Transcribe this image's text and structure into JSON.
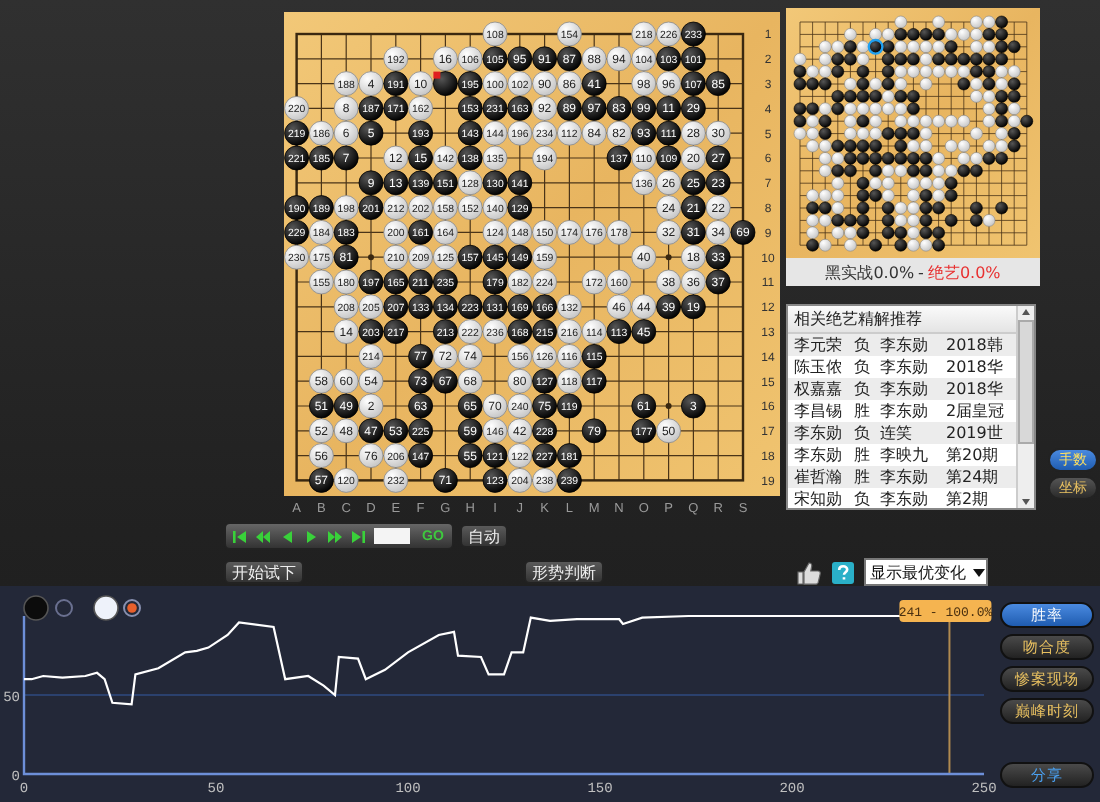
{
  "board": {
    "columns": [
      "A",
      "B",
      "C",
      "D",
      "E",
      "F",
      "G",
      "H",
      "I",
      "J",
      "K",
      "L",
      "M",
      "N",
      "O",
      "P",
      "Q",
      "R",
      "S"
    ],
    "rows": [
      {
        "label": "1",
        "points": [
          {
            "kind": "empty"
          },
          {
            "kind": "empty"
          },
          {
            "kind": "empty"
          },
          {
            "kind": "empty"
          },
          {
            "kind": "empty"
          },
          {
            "kind": "empty"
          },
          {
            "kind": "empty"
          },
          {
            "kind": "empty"
          },
          {
            "kind": "white",
            "label": "108",
            "last_move": false
          },
          {
            "kind": "empty"
          },
          {
            "kind": "empty"
          },
          {
            "kind": "white",
            "label": "154",
            "last_move": false
          },
          {
            "kind": "empty"
          },
          {
            "kind": "empty"
          },
          {
            "kind": "white",
            "label": "218",
            "last_move": false
          },
          {
            "kind": "white",
            "label": "226",
            "last_move": false
          },
          {
            "kind": "black",
            "label": "233",
            "last_move": false
          },
          {
            "kind": "empty"
          },
          {
            "kind": "empty"
          }
        ]
      },
      {
        "label": "2",
        "points": [
          {
            "kind": "empty"
          },
          {
            "kind": "empty"
          },
          {
            "kind": "empty"
          },
          {
            "kind": "empty"
          },
          {
            "kind": "white",
            "label": "192",
            "last_move": false
          },
          {
            "kind": "empty"
          },
          {
            "kind": "white",
            "label": "16",
            "last_move": false
          },
          {
            "kind": "white",
            "label": "106",
            "last_move": false
          },
          {
            "kind": "black",
            "label": "105",
            "last_move": false
          },
          {
            "kind": "black",
            "label": "95",
            "last_move": false
          },
          {
            "kind": "black",
            "label": "91",
            "last_move": false
          },
          {
            "kind": "black",
            "label": "87",
            "last_move": false
          },
          {
            "kind": "white",
            "label": "88",
            "last_move": false
          },
          {
            "kind": "white",
            "label": "94",
            "last_move": false
          },
          {
            "kind": "white",
            "label": "104",
            "last_move": false
          },
          {
            "kind": "black",
            "label": "103",
            "last_move": false
          },
          {
            "kind": "black",
            "label": "101",
            "last_move": false
          },
          {
            "kind": "empty"
          },
          {
            "kind": "empty"
          }
        ]
      },
      {
        "label": "3",
        "points": [
          {
            "kind": "empty"
          },
          {
            "kind": "empty"
          },
          {
            "kind": "white",
            "label": "188",
            "last_move": false
          },
          {
            "kind": "white",
            "label": "4",
            "last_move": false
          },
          {
            "kind": "black",
            "label": "191",
            "last_move": false
          },
          {
            "kind": "white",
            "label": "10",
            "last_move": false
          },
          {
            "kind": "black",
            "last_move": true
          },
          {
            "kind": "black",
            "label": "195",
            "last_move": false
          },
          {
            "kind": "white",
            "label": "100",
            "last_move": false
          },
          {
            "kind": "white",
            "label": "102",
            "last_move": false
          },
          {
            "kind": "white",
            "label": "90",
            "last_move": false
          },
          {
            "kind": "white",
            "label": "86",
            "last_move": false
          },
          {
            "kind": "black",
            "label": "41",
            "last_move": false
          },
          {
            "kind": "empty"
          },
          {
            "kind": "white",
            "label": "98",
            "last_move": false
          },
          {
            "kind": "white",
            "label": "96",
            "last_move": false
          },
          {
            "kind": "black",
            "label": "107",
            "last_move": false
          },
          {
            "kind": "black",
            "label": "85",
            "last_move": false
          },
          {
            "kind": "empty"
          }
        ]
      },
      {
        "label": "4",
        "points": [
          {
            "kind": "white",
            "label": "220",
            "last_move": false
          },
          {
            "kind": "empty"
          },
          {
            "kind": "white",
            "label": "8",
            "last_move": false
          },
          {
            "kind": "black",
            "label": "187",
            "last_move": false
          },
          {
            "kind": "black",
            "label": "171",
            "last_move": false
          },
          {
            "kind": "white",
            "label": "162",
            "last_move": false
          },
          {
            "kind": "empty"
          },
          {
            "kind": "black",
            "label": "153",
            "last_move": false
          },
          {
            "kind": "black",
            "label": "231",
            "last_move": false
          },
          {
            "kind": "black",
            "label": "163",
            "last_move": false
          },
          {
            "kind": "white",
            "label": "92",
            "last_move": false
          },
          {
            "kind": "black",
            "label": "89",
            "last_move": false
          },
          {
            "kind": "black",
            "label": "97",
            "last_move": false
          },
          {
            "kind": "black",
            "label": "83",
            "last_move": false
          },
          {
            "kind": "black",
            "label": "99",
            "last_move": false
          },
          {
            "kind": "black",
            "label": "11",
            "last_move": false
          },
          {
            "kind": "black",
            "label": "29",
            "last_move": false
          },
          {
            "kind": "empty"
          },
          {
            "kind": "empty"
          }
        ]
      },
      {
        "label": "5",
        "points": [
          {
            "kind": "black",
            "label": "219",
            "last_move": false
          },
          {
            "kind": "white",
            "label": "186",
            "last_move": false
          },
          {
            "kind": "white",
            "label": "6",
            "last_move": false
          },
          {
            "kind": "black",
            "label": "5",
            "last_move": false
          },
          {
            "kind": "empty"
          },
          {
            "kind": "black",
            "label": "193",
            "last_move": false
          },
          {
            "kind": "empty"
          },
          {
            "kind": "black",
            "label": "143",
            "last_move": false
          },
          {
            "kind": "white",
            "label": "144",
            "last_move": false
          },
          {
            "kind": "white",
            "label": "196",
            "last_move": false
          },
          {
            "kind": "white",
            "label": "234",
            "last_move": false
          },
          {
            "kind": "white",
            "label": "112",
            "last_move": false
          },
          {
            "kind": "white",
            "label": "84",
            "last_move": false
          },
          {
            "kind": "white",
            "label": "82",
            "last_move": false
          },
          {
            "kind": "black",
            "label": "93",
            "last_move": false
          },
          {
            "kind": "black",
            "label": "111",
            "last_move": false
          },
          {
            "kind": "white",
            "label": "28",
            "last_move": false
          },
          {
            "kind": "white",
            "label": "30",
            "last_move": false
          },
          {
            "kind": "empty"
          }
        ]
      },
      {
        "label": "6",
        "points": [
          {
            "kind": "black",
            "label": "221",
            "last_move": false
          },
          {
            "kind": "black",
            "label": "185",
            "last_move": false
          },
          {
            "kind": "black",
            "label": "7",
            "last_move": false
          },
          {
            "kind": "empty"
          },
          {
            "kind": "white",
            "label": "12",
            "last_move": false
          },
          {
            "kind": "black",
            "label": "15",
            "last_move": false
          },
          {
            "kind": "white",
            "label": "142",
            "last_move": false
          },
          {
            "kind": "black",
            "label": "138",
            "last_move": false
          },
          {
            "kind": "white",
            "label": "135",
            "last_move": false
          },
          {
            "kind": "empty"
          },
          {
            "kind": "white",
            "label": "194",
            "last_move": false
          },
          {
            "kind": "empty"
          },
          {
            "kind": "empty"
          },
          {
            "kind": "black",
            "label": "137",
            "last_move": false
          },
          {
            "kind": "white",
            "label": "110",
            "last_move": false
          },
          {
            "kind": "black",
            "label": "109",
            "last_move": false
          },
          {
            "kind": "white",
            "label": "20",
            "last_move": false
          },
          {
            "kind": "black",
            "label": "27",
            "last_move": false
          },
          {
            "kind": "empty"
          }
        ]
      },
      {
        "label": "7",
        "points": [
          {
            "kind": "empty"
          },
          {
            "kind": "empty"
          },
          {
            "kind": "empty"
          },
          {
            "kind": "black",
            "label": "9",
            "last_move": false
          },
          {
            "kind": "black",
            "label": "13",
            "last_move": false
          },
          {
            "kind": "black",
            "label": "139",
            "last_move": false
          },
          {
            "kind": "black",
            "label": "151",
            "last_move": false
          },
          {
            "kind": "white",
            "label": "128",
            "last_move": false
          },
          {
            "kind": "black",
            "label": "130",
            "last_move": false
          },
          {
            "kind": "black",
            "label": "141",
            "last_move": false
          },
          {
            "kind": "empty"
          },
          {
            "kind": "empty"
          },
          {
            "kind": "empty"
          },
          {
            "kind": "empty"
          },
          {
            "kind": "white",
            "label": "136",
            "last_move": false
          },
          {
            "kind": "white",
            "label": "26",
            "last_move": false
          },
          {
            "kind": "black",
            "label": "25",
            "last_move": false
          },
          {
            "kind": "black",
            "label": "23",
            "last_move": false
          },
          {
            "kind": "empty"
          }
        ]
      },
      {
        "label": "8",
        "points": [
          {
            "kind": "black",
            "label": "190",
            "last_move": false
          },
          {
            "kind": "black",
            "label": "189",
            "last_move": false
          },
          {
            "kind": "white",
            "label": "198",
            "last_move": false
          },
          {
            "kind": "black",
            "label": "201",
            "last_move": false
          },
          {
            "kind": "white",
            "label": "212",
            "last_move": false
          },
          {
            "kind": "white",
            "label": "202",
            "last_move": false
          },
          {
            "kind": "white",
            "label": "158",
            "last_move": false
          },
          {
            "kind": "white",
            "label": "152",
            "last_move": false
          },
          {
            "kind": "white",
            "label": "140",
            "last_move": false
          },
          {
            "kind": "black",
            "label": "129",
            "last_move": false
          },
          {
            "kind": "empty"
          },
          {
            "kind": "empty"
          },
          {
            "kind": "empty"
          },
          {
            "kind": "empty"
          },
          {
            "kind": "empty"
          },
          {
            "kind": "white",
            "label": "24",
            "last_move": false
          },
          {
            "kind": "black",
            "label": "21",
            "last_move": false
          },
          {
            "kind": "white",
            "label": "22",
            "last_move": false
          },
          {
            "kind": "empty"
          }
        ]
      },
      {
        "label": "9",
        "points": [
          {
            "kind": "black",
            "label": "229",
            "last_move": false
          },
          {
            "kind": "white",
            "label": "184",
            "last_move": false
          },
          {
            "kind": "black",
            "label": "183",
            "last_move": false
          },
          {
            "kind": "empty"
          },
          {
            "kind": "white",
            "label": "200",
            "last_move": false
          },
          {
            "kind": "black",
            "label": "161",
            "last_move": false
          },
          {
            "kind": "white",
            "label": "164",
            "last_move": false
          },
          {
            "kind": "empty"
          },
          {
            "kind": "white",
            "label": "124",
            "last_move": false
          },
          {
            "kind": "white",
            "label": "148",
            "last_move": false
          },
          {
            "kind": "white",
            "label": "150",
            "last_move": false
          },
          {
            "kind": "white",
            "label": "174",
            "last_move": false
          },
          {
            "kind": "white",
            "label": "176",
            "last_move": false
          },
          {
            "kind": "white",
            "label": "178",
            "last_move": false
          },
          {
            "kind": "empty"
          },
          {
            "kind": "white",
            "label": "32",
            "last_move": false
          },
          {
            "kind": "black",
            "label": "31",
            "last_move": false
          },
          {
            "kind": "white",
            "label": "34",
            "last_move": false
          },
          {
            "kind": "black",
            "label": "69",
            "last_move": false
          }
        ]
      },
      {
        "label": "10",
        "points": [
          {
            "kind": "white",
            "label": "230",
            "last_move": false
          },
          {
            "kind": "white",
            "label": "175",
            "last_move": false
          },
          {
            "kind": "black",
            "label": "81",
            "last_move": false
          },
          {
            "kind": "empty"
          },
          {
            "kind": "white",
            "label": "210",
            "last_move": false
          },
          {
            "kind": "white",
            "label": "209",
            "last_move": false
          },
          {
            "kind": "white",
            "label": "125",
            "last_move": false
          },
          {
            "kind": "black",
            "label": "157",
            "last_move": false
          },
          {
            "kind": "black",
            "label": "145",
            "last_move": false
          },
          {
            "kind": "black",
            "label": "149",
            "last_move": false
          },
          {
            "kind": "white",
            "label": "159",
            "last_move": false
          },
          {
            "kind": "empty"
          },
          {
            "kind": "empty"
          },
          {
            "kind": "empty"
          },
          {
            "kind": "white",
            "label": "40",
            "last_move": false
          },
          {
            "kind": "empty"
          },
          {
            "kind": "white",
            "label": "18",
            "last_move": false
          },
          {
            "kind": "black",
            "label": "33",
            "last_move": false
          },
          {
            "kind": "empty"
          }
        ]
      },
      {
        "label": "11",
        "points": [
          {
            "kind": "empty"
          },
          {
            "kind": "white",
            "label": "155",
            "last_move": false
          },
          {
            "kind": "white",
            "label": "180",
            "last_move": false
          },
          {
            "kind": "black",
            "label": "197",
            "last_move": false
          },
          {
            "kind": "black",
            "label": "165",
            "last_move": false
          },
          {
            "kind": "black",
            "label": "211",
            "last_move": false
          },
          {
            "kind": "black",
            "label": "235",
            "last_move": false
          },
          {
            "kind": "empty"
          },
          {
            "kind": "black",
            "label": "179",
            "last_move": false
          },
          {
            "kind": "white",
            "label": "182",
            "last_move": false
          },
          {
            "kind": "white",
            "label": "224",
            "last_move": false
          },
          {
            "kind": "empty"
          },
          {
            "kind": "white",
            "label": "172",
            "last_move": false
          },
          {
            "kind": "white",
            "label": "160",
            "last_move": false
          },
          {
            "kind": "empty"
          },
          {
            "kind": "white",
            "label": "38",
            "last_move": false
          },
          {
            "kind": "white",
            "label": "36",
            "last_move": false
          },
          {
            "kind": "black",
            "label": "37",
            "last_move": false
          },
          {
            "kind": "empty"
          }
        ]
      },
      {
        "label": "12",
        "points": [
          {
            "kind": "empty"
          },
          {
            "kind": "empty"
          },
          {
            "kind": "white",
            "label": "208",
            "last_move": false
          },
          {
            "kind": "white",
            "label": "205",
            "last_move": false
          },
          {
            "kind": "black",
            "label": "207",
            "last_move": false
          },
          {
            "kind": "black",
            "label": "133",
            "last_move": false
          },
          {
            "kind": "black",
            "label": "134",
            "last_move": false
          },
          {
            "kind": "black",
            "label": "223",
            "last_move": false
          },
          {
            "kind": "black",
            "label": "131",
            "last_move": false
          },
          {
            "kind": "black",
            "label": "169",
            "last_move": false
          },
          {
            "kind": "black",
            "label": "166",
            "last_move": false
          },
          {
            "kind": "white",
            "label": "132",
            "last_move": false
          },
          {
            "kind": "empty"
          },
          {
            "kind": "white",
            "label": "46",
            "last_move": false
          },
          {
            "kind": "white",
            "label": "44",
            "last_move": false
          },
          {
            "kind": "black",
            "label": "39",
            "last_move": false
          },
          {
            "kind": "black",
            "label": "19",
            "last_move": false
          },
          {
            "kind": "empty"
          },
          {
            "kind": "empty"
          }
        ]
      },
      {
        "label": "13",
        "points": [
          {
            "kind": "empty"
          },
          {
            "kind": "empty"
          },
          {
            "kind": "white",
            "label": "14",
            "last_move": false
          },
          {
            "kind": "black",
            "label": "203",
            "last_move": false
          },
          {
            "kind": "black",
            "label": "217",
            "last_move": false
          },
          {
            "kind": "empty"
          },
          {
            "kind": "black",
            "label": "213",
            "last_move": false
          },
          {
            "kind": "white",
            "label": "222",
            "last_move": false
          },
          {
            "kind": "white",
            "label": "236",
            "last_move": false
          },
          {
            "kind": "black",
            "label": "168",
            "last_move": false
          },
          {
            "kind": "black",
            "label": "215",
            "last_move": false
          },
          {
            "kind": "white",
            "label": "216",
            "last_move": false
          },
          {
            "kind": "white",
            "label": "114",
            "last_move": false
          },
          {
            "kind": "black",
            "label": "113",
            "last_move": false
          },
          {
            "kind": "black",
            "label": "45",
            "last_move": false
          },
          {
            "kind": "empty"
          },
          {
            "kind": "empty"
          },
          {
            "kind": "empty"
          },
          {
            "kind": "empty"
          }
        ]
      },
      {
        "label": "14",
        "points": [
          {
            "kind": "empty"
          },
          {
            "kind": "empty"
          },
          {
            "kind": "empty"
          },
          {
            "kind": "white",
            "label": "214",
            "last_move": false
          },
          {
            "kind": "empty"
          },
          {
            "kind": "black",
            "label": "77",
            "last_move": false
          },
          {
            "kind": "white",
            "label": "72",
            "last_move": false
          },
          {
            "kind": "white",
            "label": "74",
            "last_move": false
          },
          {
            "kind": "empty"
          },
          {
            "kind": "white",
            "label": "156",
            "last_move": false
          },
          {
            "kind": "white",
            "label": "126",
            "last_move": false
          },
          {
            "kind": "white",
            "label": "116",
            "last_move": false
          },
          {
            "kind": "black",
            "label": "115",
            "last_move": false
          },
          {
            "kind": "empty"
          },
          {
            "kind": "empty"
          },
          {
            "kind": "empty"
          },
          {
            "kind": "empty"
          },
          {
            "kind": "empty"
          },
          {
            "kind": "empty"
          }
        ]
      },
      {
        "label": "15",
        "points": [
          {
            "kind": "empty"
          },
          {
            "kind": "white",
            "label": "58",
            "last_move": false
          },
          {
            "kind": "white",
            "label": "60",
            "last_move": false
          },
          {
            "kind": "white",
            "label": "54",
            "last_move": false
          },
          {
            "kind": "empty"
          },
          {
            "kind": "black",
            "label": "73",
            "last_move": false
          },
          {
            "kind": "black",
            "label": "67",
            "last_move": false
          },
          {
            "kind": "white",
            "label": "68",
            "last_move": false
          },
          {
            "kind": "empty"
          },
          {
            "kind": "white",
            "label": "80",
            "last_move": false
          },
          {
            "kind": "black",
            "label": "127",
            "last_move": false
          },
          {
            "kind": "white",
            "label": "118",
            "last_move": false
          },
          {
            "kind": "black",
            "label": "117",
            "last_move": false
          },
          {
            "kind": "empty"
          },
          {
            "kind": "empty"
          },
          {
            "kind": "empty"
          },
          {
            "kind": "empty"
          },
          {
            "kind": "empty"
          },
          {
            "kind": "empty"
          }
        ]
      },
      {
        "label": "16",
        "points": [
          {
            "kind": "empty"
          },
          {
            "kind": "black",
            "label": "51",
            "last_move": false
          },
          {
            "kind": "black",
            "label": "49",
            "last_move": false
          },
          {
            "kind": "white",
            "label": "2",
            "last_move": false
          },
          {
            "kind": "empty"
          },
          {
            "kind": "black",
            "label": "63",
            "last_move": false
          },
          {
            "kind": "empty"
          },
          {
            "kind": "black",
            "label": "65",
            "last_move": false
          },
          {
            "kind": "white",
            "label": "70",
            "last_move": false
          },
          {
            "kind": "white",
            "label": "240",
            "last_move": false
          },
          {
            "kind": "black",
            "label": "75",
            "last_move": false
          },
          {
            "kind": "black",
            "label": "119",
            "last_move": false
          },
          {
            "kind": "empty"
          },
          {
            "kind": "empty"
          },
          {
            "kind": "black",
            "label": "61",
            "last_move": false
          },
          {
            "kind": "empty"
          },
          {
            "kind": "black",
            "label": "3",
            "last_move": false
          },
          {
            "kind": "empty"
          },
          {
            "kind": "empty"
          }
        ]
      },
      {
        "label": "17",
        "points": [
          {
            "kind": "empty"
          },
          {
            "kind": "white",
            "label": "52",
            "last_move": false
          },
          {
            "kind": "white",
            "label": "48",
            "last_move": false
          },
          {
            "kind": "black",
            "label": "47",
            "last_move": false
          },
          {
            "kind": "black",
            "label": "53",
            "last_move": false
          },
          {
            "kind": "black",
            "label": "225",
            "last_move": false
          },
          {
            "kind": "empty"
          },
          {
            "kind": "black",
            "label": "59",
            "last_move": false
          },
          {
            "kind": "white",
            "label": "146",
            "last_move": false
          },
          {
            "kind": "white",
            "label": "42",
            "last_move": false
          },
          {
            "kind": "black",
            "label": "228",
            "last_move": false
          },
          {
            "kind": "empty"
          },
          {
            "kind": "black",
            "label": "79",
            "last_move": false
          },
          {
            "kind": "empty"
          },
          {
            "kind": "black",
            "label": "177",
            "last_move": false
          },
          {
            "kind": "white",
            "label": "50",
            "last_move": false
          },
          {
            "kind": "empty"
          },
          {
            "kind": "empty"
          },
          {
            "kind": "empty"
          }
        ]
      },
      {
        "label": "18",
        "points": [
          {
            "kind": "empty"
          },
          {
            "kind": "white",
            "label": "56",
            "last_move": false
          },
          {
            "kind": "empty"
          },
          {
            "kind": "white",
            "label": "76",
            "last_move": false
          },
          {
            "kind": "white",
            "label": "206",
            "last_move": false
          },
          {
            "kind": "black",
            "label": "147",
            "last_move": false
          },
          {
            "kind": "empty"
          },
          {
            "kind": "black",
            "label": "55",
            "last_move": false
          },
          {
            "kind": "black",
            "label": "121",
            "last_move": false
          },
          {
            "kind": "white",
            "label": "122",
            "last_move": false
          },
          {
            "kind": "black",
            "label": "227",
            "last_move": false
          },
          {
            "kind": "black",
            "label": "181",
            "last_move": false
          },
          {
            "kind": "empty"
          },
          {
            "kind": "empty"
          },
          {
            "kind": "empty"
          },
          {
            "kind": "empty"
          },
          {
            "kind": "empty"
          },
          {
            "kind": "empty"
          },
          {
            "kind": "empty"
          }
        ]
      },
      {
        "label": "19",
        "points": [
          {
            "kind": "empty"
          },
          {
            "kind": "black",
            "label": "57",
            "last_move": false
          },
          {
            "kind": "white",
            "label": "120",
            "last_move": false
          },
          {
            "kind": "empty"
          },
          {
            "kind": "white",
            "label": "232",
            "last_move": false
          },
          {
            "kind": "empty"
          },
          {
            "kind": "black",
            "label": "71",
            "last_move": false
          },
          {
            "kind": "empty"
          },
          {
            "kind": "black",
            "label": "123",
            "last_move": false
          },
          {
            "kind": "white",
            "label": "204",
            "last_move": false
          },
          {
            "kind": "white",
            "label": "238",
            "last_move": false
          },
          {
            "kind": "black",
            "label": "239",
            "last_move": false
          },
          {
            "kind": "empty"
          },
          {
            "kind": "empty"
          },
          {
            "kind": "empty"
          },
          {
            "kind": "empty"
          },
          {
            "kind": "empty"
          },
          {
            "kind": "empty"
          },
          {
            "kind": "empty"
          }
        ]
      }
    ]
  },
  "mini_board": {
    "black_rate": "黑实战0.0%",
    "separator": "-",
    "ai_rate": "绝艺0.0%"
  },
  "recommendations": {
    "title": "相关绝艺精解推荐",
    "rows": [
      {
        "black": "李元荣",
        "result": "负",
        "white": "李东勋",
        "event": "2018韩"
      },
      {
        "black": "陈玉侬",
        "result": "负",
        "white": "李东勋",
        "event": "2018华"
      },
      {
        "black": "权嘉嘉",
        "result": "负",
        "white": "李东勋",
        "event": "2018华"
      },
      {
        "black": "李昌锡",
        "result": "胜",
        "white": "李东勋",
        "event": "2届皇冠"
      },
      {
        "black": "李东勋",
        "result": "负",
        "white": "连笑",
        "event": "2019世"
      },
      {
        "black": "李东勋",
        "result": "胜",
        "white": "李映九",
        "event": "第20期"
      },
      {
        "black": "崔哲瀚",
        "result": "胜",
        "white": "李东勋",
        "event": "第24期"
      },
      {
        "black": "宋知勋",
        "result": "负",
        "white": "李东勋",
        "event": "第2期"
      }
    ]
  },
  "display_toggles": [
    {
      "label": "手数",
      "selected": true
    },
    {
      "label": "坐标",
      "selected": false
    }
  ],
  "playback": {
    "go_label": "GO",
    "auto_button": "自动"
  },
  "actions": {
    "try_button": "开始试下",
    "judge_button": "形势判断",
    "variation_select": "显示最优变化"
  },
  "chart_tabs": [
    {
      "label": "胜率",
      "selected": true
    },
    {
      "label": "吻合度",
      "selected": false
    },
    {
      "label": "惨案现场",
      "selected": false
    },
    {
      "label": "巅峰时刻",
      "selected": false
    }
  ],
  "share_button": "分享",
  "winrate": {
    "chart_data": {
      "type": "line",
      "x": [
        0,
        2,
        5,
        10,
        16,
        19,
        21,
        23,
        28,
        29,
        35,
        42,
        45,
        48,
        53,
        56,
        65,
        68,
        74,
        78,
        81,
        82,
        87,
        89,
        94,
        100,
        108,
        112,
        113,
        119,
        121,
        125,
        127,
        130,
        132,
        137,
        144,
        155,
        156,
        161,
        173,
        229
      ],
      "series": [
        {
          "color": "#ffffff",
          "values": [
            60,
            60,
            62,
            61,
            62,
            64,
            60,
            45,
            44,
            63,
            67,
            77,
            78,
            80,
            88,
            96,
            93,
            60,
            62,
            56,
            50,
            74,
            73,
            60,
            66,
            77,
            88,
            90,
            75,
            74,
            63,
            63,
            77,
            77,
            99,
            97,
            98,
            98,
            95,
            99,
            100,
            100
          ]
        }
      ],
      "xlim": [
        0,
        250
      ],
      "ylim": [
        0,
        100
      ],
      "xticks": [
        0,
        50,
        100,
        150,
        200,
        250
      ],
      "yticks": [
        0,
        50
      ],
      "ref_lines": [
        {
          "axis": "y",
          "value": 50
        },
        {
          "axis": "x",
          "value": 241
        }
      ],
      "annotations": [
        "241 - 100.0%"
      ]
    }
  }
}
